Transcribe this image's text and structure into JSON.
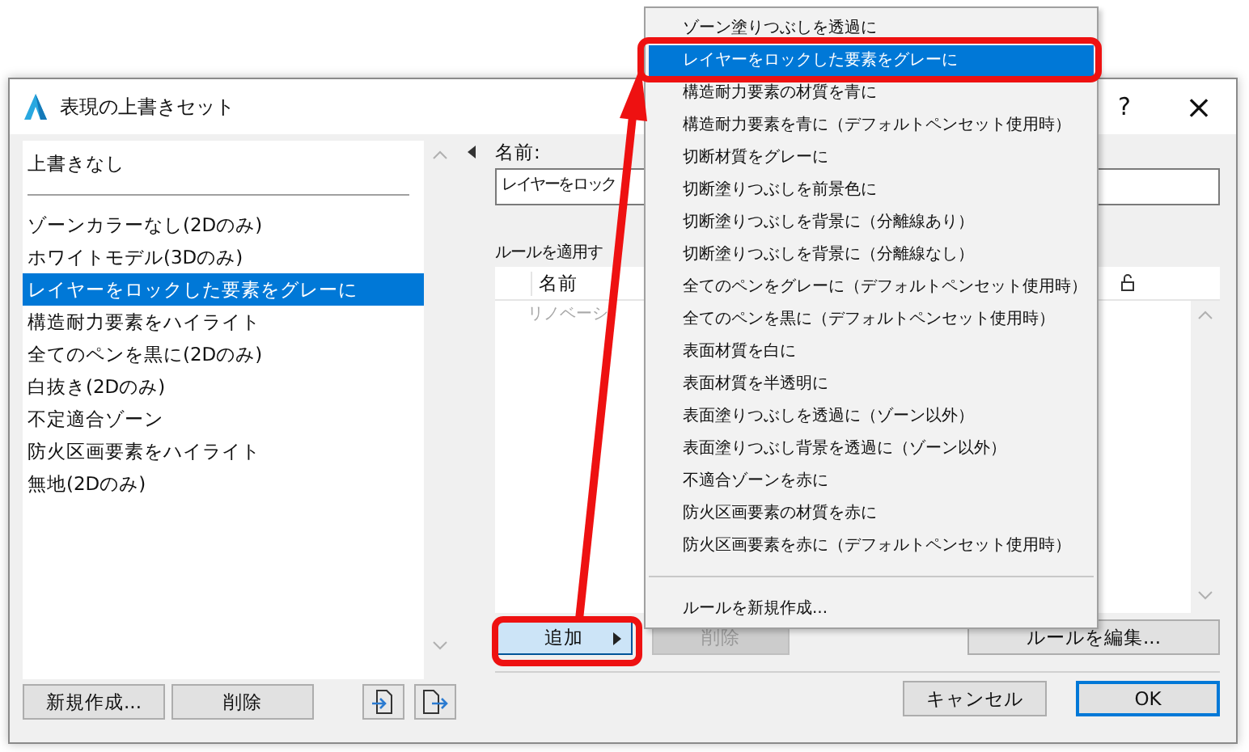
{
  "window": {
    "title": "表現の上書きセット",
    "help": "?",
    "close": "×"
  },
  "override_list": {
    "default_item": {
      "label": "上書きなし",
      "selected": false
    },
    "items": [
      {
        "label": "ゾーンカラーなし(2Dのみ)",
        "selected": false
      },
      {
        "label": "ホワイトモデル(3Dのみ)",
        "selected": false
      },
      {
        "label": "レイヤーをロックした要素をグレーに",
        "selected": true
      },
      {
        "label": "構造耐力要素をハイライト",
        "selected": false
      },
      {
        "label": "全てのペンを黒に(2Dのみ)",
        "selected": false
      },
      {
        "label": "白抜き(2Dのみ)",
        "selected": false
      },
      {
        "label": "不定適合ゾーン",
        "selected": false
      },
      {
        "label": "防火区画要素をハイライト",
        "selected": false
      },
      {
        "label": "無地(2Dのみ)",
        "selected": false
      }
    ],
    "buttons": [
      {
        "label": "新規作成...",
        "disabled": false
      },
      {
        "label": "削除",
        "disabled": false
      }
    ]
  },
  "details": {
    "name_label": "名前:",
    "name_value": "レイヤーをロック",
    "rules_label": "ルールを適用す",
    "rules_table": {
      "columns": [
        "名前"
      ],
      "rows": [
        "リノベーシ"
      ]
    },
    "buttons": [
      {
        "label": "追加",
        "disabled": false,
        "highlighted": true
      },
      {
        "label": "削除",
        "disabled": true,
        "highlighted": false
      },
      {
        "label": "ルールを編集...",
        "disabled": false,
        "highlighted": false
      }
    ]
  },
  "dialog_buttons": [
    {
      "label": "キャンセル",
      "default": false
    },
    {
      "label": "OK",
      "default": true
    }
  ],
  "add_menu": {
    "items": [
      {
        "label": "ゾーン塗りつぶしを透過に",
        "selected": false
      },
      {
        "label": "レイヤーをロックした要素をグレーに",
        "selected": true
      },
      {
        "label": "構造耐力要素の材質を青に",
        "selected": false
      },
      {
        "label": "構造耐力要素を青に（デフォルトペンセット使用時）",
        "selected": false
      },
      {
        "label": "切断材質をグレーに",
        "selected": false
      },
      {
        "label": "切断塗りつぶしを前景色に",
        "selected": false
      },
      {
        "label": "切断塗りつぶしを背景に（分離線あり）",
        "selected": false
      },
      {
        "label": "切断塗りつぶしを背景に（分離線なし）",
        "selected": false
      },
      {
        "label": "全てのペンをグレーに（デフォルトペンセット使用時）",
        "selected": false
      },
      {
        "label": "全てのペンを黒に（デフォルトペンセット使用時）",
        "selected": false
      },
      {
        "label": "表面材質を白に",
        "selected": false
      },
      {
        "label": "表面材質を半透明に",
        "selected": false
      },
      {
        "label": "表面塗りつぶしを透過に（ゾーン以外）",
        "selected": false
      },
      {
        "label": "表面塗りつぶし背景を透過に（ゾーン以外）",
        "selected": false
      },
      {
        "label": "不適合ゾーンを赤に",
        "selected": false
      },
      {
        "label": "防火区画要素の材質を赤に",
        "selected": false
      },
      {
        "label": "防火区画要素を赤に（デフォルトペンセット使用時）",
        "selected": false
      }
    ],
    "footer_item": "ルールを新規作成..."
  }
}
